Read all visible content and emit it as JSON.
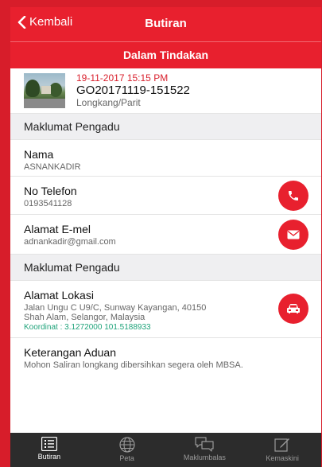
{
  "nav": {
    "back_label": "Kembali",
    "title": "Butiran"
  },
  "status": {
    "label": "Dalam Tindakan"
  },
  "summary": {
    "date": "19-11-2017 15:15 PM",
    "id": "GO20171119-151522",
    "category": "Longkang/Parit"
  },
  "sections": {
    "complainant": "Maklumat Pengadu",
    "complainant2": "Maklumat Pengadu"
  },
  "fields": {
    "name_label": "Nama",
    "name_value": "ASNANKADIR",
    "phone_label": "No Telefon",
    "phone_value": "0193541128",
    "email_label": "Alamat E-mel",
    "email_value": "adnankadir@gmail.com",
    "location_label": "Alamat Lokasi",
    "location_line1": "Jalan Ungu C U9/C, Sunway Kayangan, 40150",
    "location_line2": "Shah Alam, Selangor, Malaysia",
    "coordinates": "Koordinat : 3.1272000 101.5188933",
    "remark_label": "Keterangan Aduan",
    "remark_value": "Mohon Saliran longkang dibersihkan segera oleh MBSA."
  },
  "tabs": [
    {
      "label": "Butiran",
      "icon": "list-icon",
      "active": true
    },
    {
      "label": "Peta",
      "icon": "globe-icon",
      "active": false
    },
    {
      "label": "Maklumbalas",
      "icon": "chat-icon",
      "active": false
    },
    {
      "label": "Kemaskini",
      "icon": "edit-icon",
      "active": false
    }
  ],
  "colors": {
    "accent": "#e8202e",
    "coordinate": "#1fa37a",
    "tabbar": "#2c2c2c"
  }
}
